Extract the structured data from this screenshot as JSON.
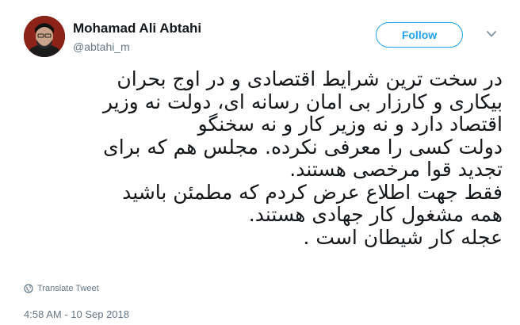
{
  "author": {
    "name": "Mohamad Ali Abtahi",
    "handle": "@abtahi_m",
    "avatar_icon": "profile-photo"
  },
  "actions": {
    "follow_label": "Follow",
    "menu_icon": "chevron-down-icon"
  },
  "tweet": {
    "lines": [
      "در سخت ترین شرایط اقتصادی و در اوج بحران",
      "بیکاری و کارزار بی امان رسانه ای،  دولت نه وزیر",
      "اقتصاد دارد و نه وزیر کار و نه سخنگو",
      "دولت کسی را معرفی نکرده. مجلس هم که برای",
      "تجدید قوا مرخصی هستند.",
      "فقط جهت اطلاع عرض کردم که مطمئن باشید",
      "همه مشغول کار جهادی هستند.",
      "عجله کار شیطان است ."
    ]
  },
  "footer": {
    "translate_label": "Translate Tweet",
    "timestamp": "4:58 AM - 10 Sep 2018"
  },
  "colors": {
    "accent": "#1da1f2",
    "muted": "#657786",
    "text": "#14171a"
  }
}
